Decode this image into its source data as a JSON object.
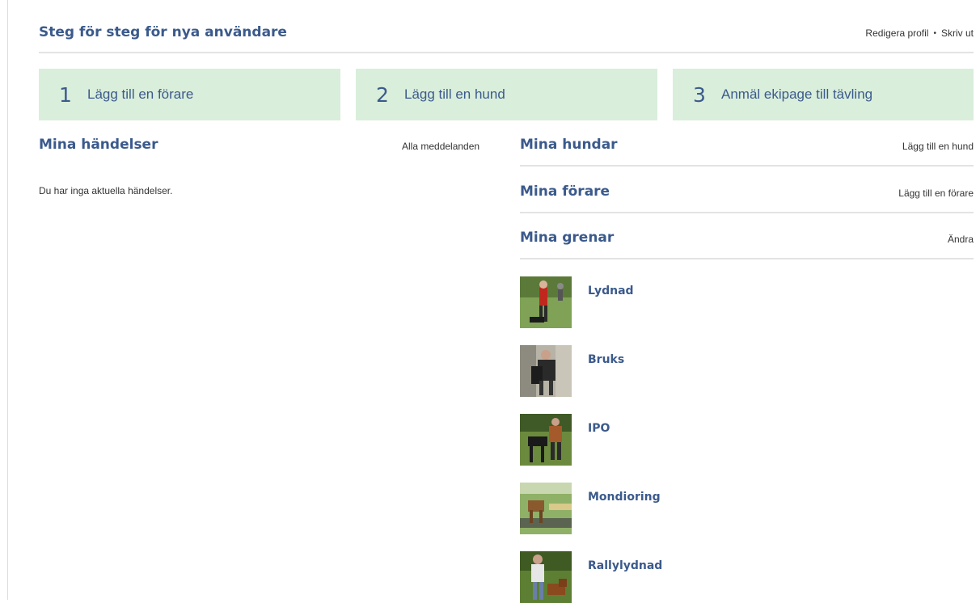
{
  "header": {
    "title": "Steg för steg för nya användare",
    "edit_profile": "Redigera profil",
    "separator": "•",
    "print": "Skriv ut"
  },
  "steps": [
    {
      "number": "1",
      "label": "Lägg till en förare"
    },
    {
      "number": "2",
      "label": "Lägg till en hund"
    },
    {
      "number": "3",
      "label": "Anmäl ekipage till tävling"
    }
  ],
  "events": {
    "title": "Mina händelser",
    "all_messages": "Alla meddelanden",
    "empty_text": "Du har inga aktuella händelser."
  },
  "dogs": {
    "title": "Mina hundar",
    "action": "Lägg till en hund"
  },
  "handlers": {
    "title": "Mina förare",
    "action": "Lägg till en förare"
  },
  "branches": {
    "title": "Mina grenar",
    "action": "Ändra",
    "items": [
      {
        "name": "Lydnad",
        "thumb": "obedience-photo"
      },
      {
        "name": "Bruks",
        "thumb": "working-dog-photo"
      },
      {
        "name": "IPO",
        "thumb": "ipo-photo"
      },
      {
        "name": "Mondioring",
        "thumb": "mondioring-photo"
      },
      {
        "name": "Rallylydnad",
        "thumb": "rally-obedience-photo"
      }
    ]
  },
  "colors": {
    "accent": "#3b5a8c",
    "step_background": "#d9eedb",
    "rule": "#e3e3e3"
  }
}
